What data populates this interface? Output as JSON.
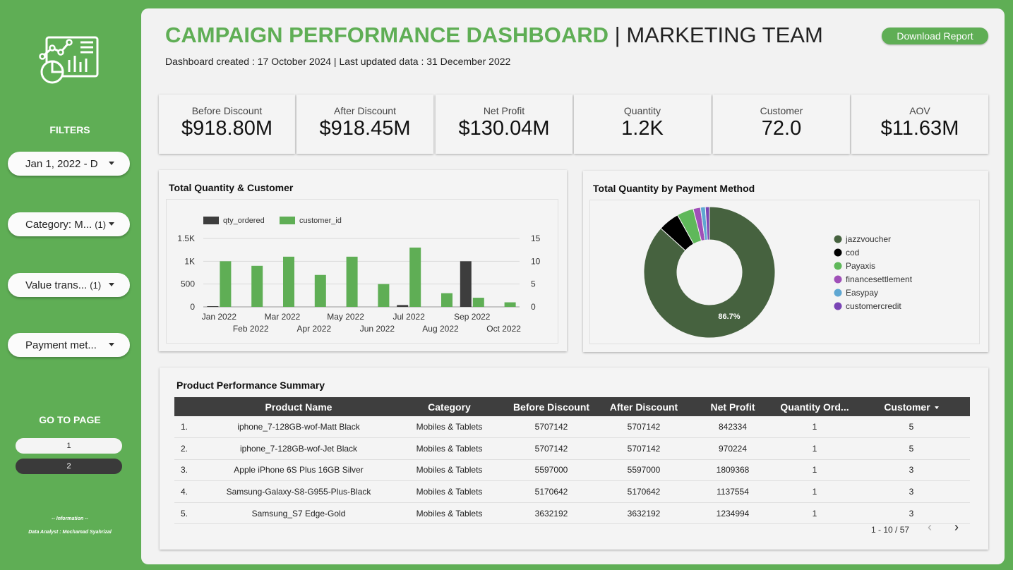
{
  "sidebar": {
    "filters_title": "FILTERS",
    "filters": [
      {
        "text": "Jan 1, 2022 - D",
        "count": ""
      },
      {
        "text": "Category: M...",
        "count": "(1)"
      },
      {
        "text": "Value trans...",
        "count": "(1)"
      },
      {
        "text": "Payment met...",
        "count": ""
      }
    ],
    "goto_title": "GO TO PAGE",
    "pages": [
      "1",
      "2"
    ],
    "info_heading": "-- Information --",
    "info_analyst": "Data Analyst : Mochamad Syahrizal"
  },
  "header": {
    "title_accent": "CAMPAIGN PERFORMANCE DASHBOARD",
    "title_rest": " | MARKETING TEAM",
    "subtitle": "Dashboard created : 17 October 2024 | Last updated data : 31 December 2022",
    "download_label": "Download Report"
  },
  "kpis": [
    {
      "label": "Before Discount",
      "value": "$918.80M"
    },
    {
      "label": "After Discount",
      "value": "$918.45M"
    },
    {
      "label": "Net Profit",
      "value": "$130.04M"
    },
    {
      "label": "Quantity",
      "value": "1.2K"
    },
    {
      "label": "Customer",
      "value": "72.0"
    },
    {
      "label": "AOV",
      "value": "$11.63M"
    }
  ],
  "colors": {
    "brand_green": "#5fae55",
    "dark_bar": "#3d3d3d",
    "donut_main": "#46623f"
  },
  "chart_data": [
    {
      "type": "bar",
      "title": "Total Quantity & Customer",
      "categories": [
        "Jan 2022",
        "Feb 2022",
        "Mar 2022",
        "Apr 2022",
        "May 2022",
        "Jun 2022",
        "Jul 2022",
        "Aug 2022",
        "Sep 2022",
        "Oct 2022"
      ],
      "series": [
        {
          "name": "qty_ordered",
          "axis": "left",
          "color": "#3d3d3d",
          "values": [
            15,
            0,
            0,
            0,
            0,
            0,
            40,
            0,
            1000,
            0
          ]
        },
        {
          "name": "customer_id",
          "axis": "right",
          "color": "#5fae55",
          "values": [
            10,
            9,
            11,
            7,
            11,
            5,
            13,
            3,
            2,
            1
          ]
        }
      ],
      "y_left": {
        "ticks": [
          "0",
          "500",
          "1K",
          "1.5K"
        ],
        "range": [
          0,
          1500
        ]
      },
      "y_right": {
        "ticks": [
          "0",
          "5",
          "10",
          "15"
        ],
        "range": [
          0,
          15
        ]
      },
      "legend": "top-left"
    },
    {
      "type": "pie",
      "title": "Total Quantity by Payment Method",
      "donut": true,
      "legend": "right",
      "slices": [
        {
          "name": "jazzvoucher",
          "value": 86.7,
          "color": "#46623f"
        },
        {
          "name": "cod",
          "value": 5.2,
          "color": "#000000"
        },
        {
          "name": "Payaxis",
          "value": 4.1,
          "color": "#5fb85a"
        },
        {
          "name": "financesettlement",
          "value": 1.8,
          "color": "#a050b8"
        },
        {
          "name": "Easypay",
          "value": 1.2,
          "color": "#5fa7d2"
        },
        {
          "name": "customercredit",
          "value": 1.0,
          "color": "#7a45b5"
        }
      ],
      "label": "86.7%"
    }
  ],
  "table": {
    "title": "Product Performance Summary",
    "columns": [
      "",
      "Product Name",
      "Category",
      "Before Discount",
      "After Discount",
      "Net Profit",
      "Quantity Ord...",
      "Customer"
    ],
    "rows": [
      [
        "1.",
        "iphone_7-128GB-wof-Matt Black",
        "Mobiles & Tablets",
        "5707142",
        "5707142",
        "842334",
        "1",
        "5"
      ],
      [
        "2.",
        "iphone_7-128GB-wof-Jet Black",
        "Mobiles & Tablets",
        "5707142",
        "5707142",
        "970224",
        "1",
        "5"
      ],
      [
        "3.",
        "Apple iPhone 6S Plus 16GB Silver",
        "Mobiles & Tablets",
        "5597000",
        "5597000",
        "1809368",
        "1",
        "3"
      ],
      [
        "4.",
        "Samsung-Galaxy-S8-G955-Plus-Black",
        "Mobiles & Tablets",
        "5170642",
        "5170642",
        "1137554",
        "1",
        "3"
      ],
      [
        "5.",
        "Samsung_S7 Edge-Gold",
        "Mobiles & Tablets",
        "3632192",
        "3632192",
        "1234994",
        "1",
        "3"
      ]
    ],
    "pagination": "1 - 10 / 57",
    "prev": "‹",
    "next": "›"
  }
}
